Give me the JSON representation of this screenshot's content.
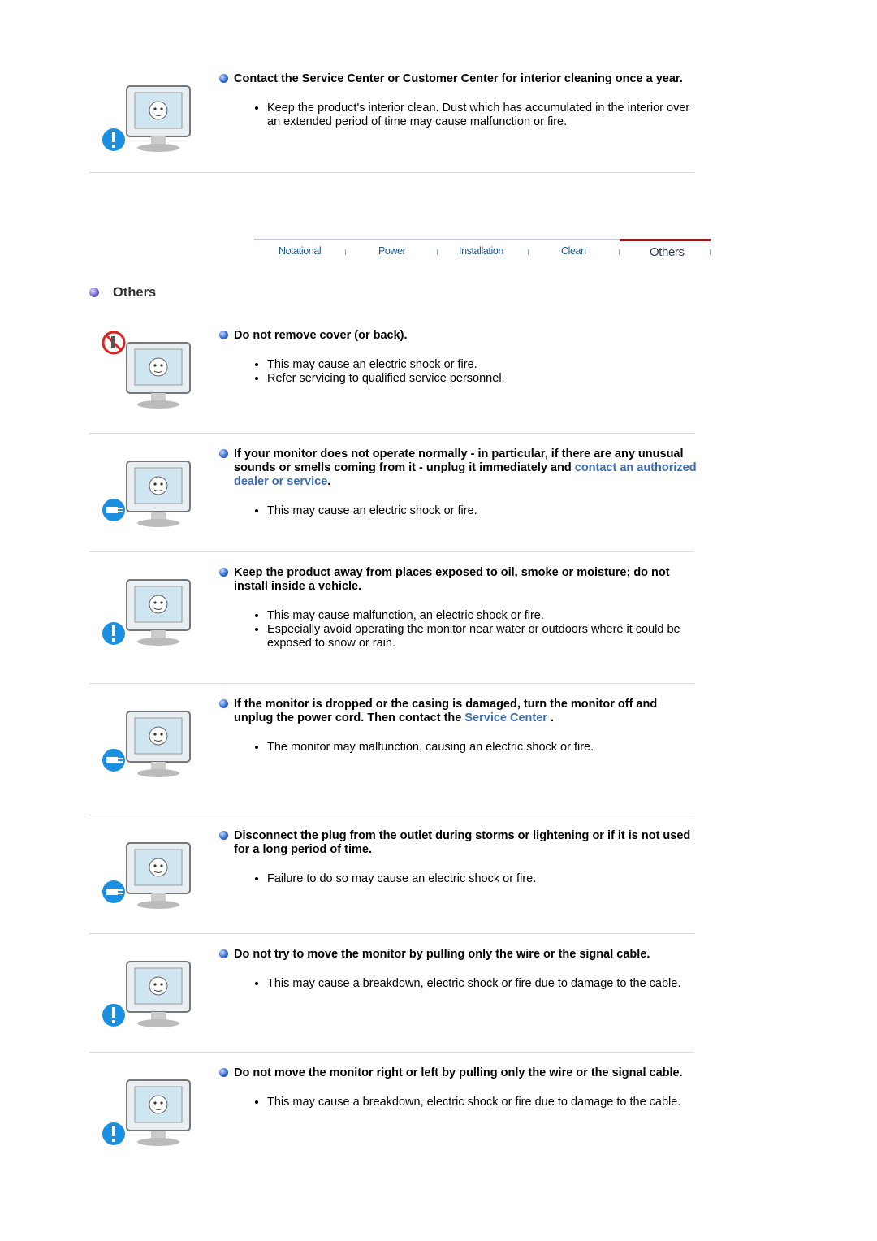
{
  "top_section": {
    "icon": "exclamation",
    "title": [
      {
        "text": "Contact the Service Center or Customer Center for interior cleaning once a year."
      }
    ],
    "bullets": [
      "Keep the product's interior clean. Dust which has accumulated in the interior over an extended period of time may cause malfunction or fire."
    ]
  },
  "tabs": [
    {
      "label": "Notational"
    },
    {
      "label": "Power"
    },
    {
      "label": "Installation"
    },
    {
      "label": "Clean"
    },
    {
      "label": "Others",
      "active": true
    }
  ],
  "heading": "Others",
  "sections": [
    {
      "icon": "prohibited",
      "title": [
        {
          "text": "Do not remove cover (or back)."
        }
      ],
      "bullets": [
        "This may cause an electric shock or fire.",
        "Refer servicing to qualified service personnel."
      ]
    },
    {
      "icon": "unplug",
      "title": [
        {
          "text": "If your monitor does not operate normally - in particular, if there are any unusual sounds or smells coming from it - unplug it immediately and "
        },
        {
          "text": "contact an authorized dealer or service",
          "link": true
        },
        {
          "text": "."
        }
      ],
      "bullets": [
        "This may cause an electric shock or fire."
      ]
    },
    {
      "icon": "exclamation",
      "title": [
        {
          "text": "Keep the product away from places exposed to oil, smoke or moisture; do not install inside a vehicle."
        }
      ],
      "bullets": [
        "This may cause malfunction, an electric shock or fire.",
        "Especially avoid operating the monitor near water or outdoors where it could be exposed to snow or rain."
      ]
    },
    {
      "icon": "unplug",
      "title": [
        {
          "text": "If the monitor is dropped or the casing is damaged, turn the monitor off and unplug the power cord. Then contact the "
        },
        {
          "text": "Service Center",
          "link": true
        },
        {
          "text": " ."
        }
      ],
      "bullets": [
        "The monitor may malfunction, causing an electric shock or fire."
      ]
    },
    {
      "icon": "unplug",
      "title": [
        {
          "text": "Disconnect the plug from the outlet during storms or lightening or if it is not used for a long period of time."
        }
      ],
      "bullets": [
        "Failure to do so may cause an electric shock or fire."
      ]
    },
    {
      "icon": "exclamation",
      "title": [
        {
          "text": "Do not try to move the monitor by pulling only the wire or the signal cable."
        }
      ],
      "bullets": [
        "This may cause a breakdown, electric shock or fire due to damage to the cable."
      ]
    },
    {
      "icon": "exclamation",
      "title": [
        {
          "text": "Do not move the monitor right or left by pulling only the wire or the signal cable."
        }
      ],
      "bullets": [
        "This may cause a breakdown, electric shock or fire due to damage to the cable."
      ]
    }
  ],
  "colors": {
    "link": "#3a6bb5",
    "active_tab_bar": "#9b1c1c",
    "tab_text": "#1f5a8a"
  }
}
